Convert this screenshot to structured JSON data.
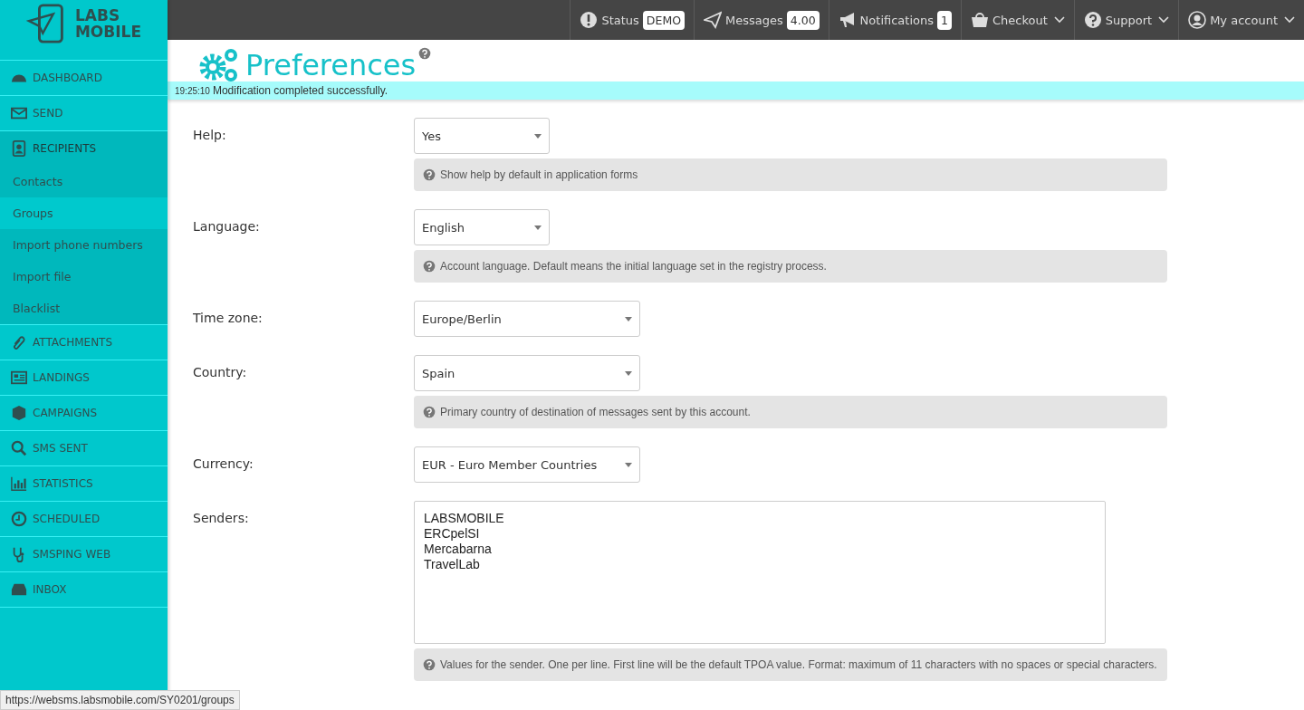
{
  "logo": {
    "line_1": "LABS",
    "line_2": "MOBILE"
  },
  "sidebar": {
    "items": [
      {
        "label": "DASHBOARD",
        "expanded": false
      },
      {
        "label": "SEND",
        "expanded": false
      },
      {
        "label": "RECIPIENTS",
        "expanded": true,
        "children": [
          {
            "label": "Contacts",
            "selected": false
          },
          {
            "label": "Groups",
            "selected": true
          },
          {
            "label": "Import phone numbers",
            "selected": false
          },
          {
            "label": "Import file",
            "selected": false
          },
          {
            "label": "Blacklist",
            "selected": false
          }
        ]
      },
      {
        "label": "ATTACHMENTS",
        "expanded": false
      },
      {
        "label": "LANDINGS",
        "expanded": false
      },
      {
        "label": "CAMPAIGNS",
        "expanded": false
      },
      {
        "label": "SMS SENT",
        "expanded": false
      },
      {
        "label": "STATISTICS",
        "expanded": false
      },
      {
        "label": "SCHEDULED",
        "expanded": false
      },
      {
        "label": "SMSPING WEB",
        "expanded": false
      },
      {
        "label": "INBOX",
        "expanded": false
      }
    ]
  },
  "topbar": {
    "items": [
      {
        "label": "Status",
        "badge": "DEMO",
        "dropdown": false
      },
      {
        "label": "Messages",
        "badge": "4.00",
        "dropdown": false
      },
      {
        "label": "Notifications",
        "badge": "1",
        "dropdown": false
      },
      {
        "label": "Checkout",
        "dropdown": true
      },
      {
        "label": "Support",
        "dropdown": true
      },
      {
        "label": "My account",
        "dropdown": true
      }
    ]
  },
  "page": {
    "title": "Preferences",
    "message": {
      "time": "19:25:10",
      "text": "Modification completed successfully."
    }
  },
  "fields": [
    {
      "label": "Help:",
      "kind": "short",
      "value": "Yes",
      "help": "Show help by default in application forms"
    },
    {
      "label": "Language:",
      "kind": "short",
      "value": "English",
      "help": "Account language. Default means the initial language set in the registry process."
    },
    {
      "label": "Time zone:",
      "kind": "long",
      "value": "Europe/Berlin"
    },
    {
      "label": "Country:",
      "kind": "long",
      "value": "Spain",
      "help": "Primary country of destination of messages sent by this account."
    },
    {
      "label": "Currency:",
      "kind": "long",
      "value": "EUR - Euro Member Countries"
    },
    {
      "label": "Senders:",
      "kind": "textarea",
      "value": "LABSMOBILE\nERCpelSI\nMercabarna\nTravelLab",
      "help": "Values for the sender. One per line. First line will be the default TPOA value. Format: maximum of 11 characters with no spaces or special characters."
    }
  ],
  "status_url": "https://websms.labsmobile.com/SY0201/groups"
}
